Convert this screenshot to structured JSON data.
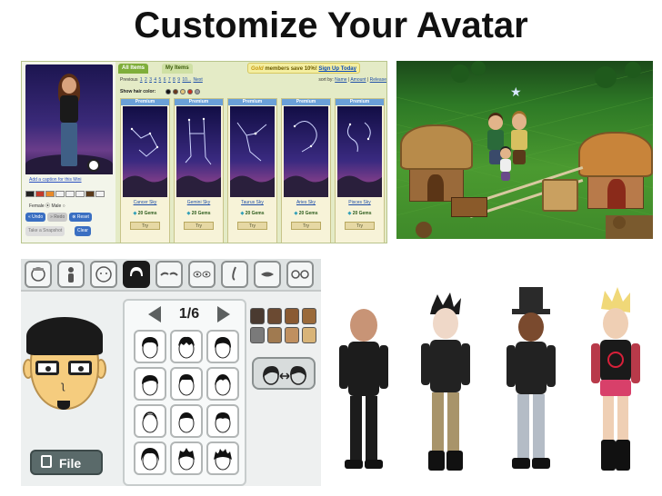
{
  "page": {
    "title": "Customize Your Avatar"
  },
  "imvu": {
    "caption_link": "Add a caption for this Mini",
    "gender_label": "Female ⦿  Male ○",
    "buttons": {
      "undo": "« Undo",
      "redo": "» Redo",
      "reset": "⊗ Reset",
      "snapshot": "Take a Snapshot",
      "clear": "Clear"
    },
    "tabs": {
      "all": "All Items",
      "my": "My Items"
    },
    "promo": {
      "brand": "Gold",
      "text": "members save 10%!",
      "signup": "Sign Up Today"
    },
    "pager": {
      "previous": "Previous",
      "pages": [
        "1",
        "2",
        "3",
        "4",
        "5",
        "6",
        "7",
        "8",
        "9",
        "10..."
      ],
      "next": "Next"
    },
    "sort": {
      "label": "sort by:",
      "options": [
        "Name",
        "Amount",
        "Release"
      ]
    },
    "hair_color_label": "Show hair color:",
    "hair_colors": [
      "#111111",
      "#6b3a1a",
      "#e4c77a",
      "#c83222",
      "#9a9a9a"
    ],
    "swatch_colors": [
      "#222222",
      "#c23a2a",
      "#e88a2a",
      "#f2f2f2",
      "#f2f2f2",
      "#f2f2f2",
      "#5a3a1a",
      "#f2f2f2"
    ],
    "items": [
      {
        "badge": "Premium",
        "name": "Cancer Sky",
        "price": "20 Gems",
        "try": "Try"
      },
      {
        "badge": "Premium",
        "name": "Gemini Sky",
        "price": "20 Gems",
        "try": "Try"
      },
      {
        "badge": "Premium",
        "name": "Taurus Sky",
        "price": "20 Gems",
        "try": "Try"
      },
      {
        "badge": "Premium",
        "name": "Aries Sky",
        "price": "20 Gems",
        "try": "Try"
      },
      {
        "badge": "Premium",
        "name": "Pisces Sky",
        "price": "20 Gems",
        "try": "Try"
      }
    ]
  },
  "mii": {
    "page_indicator": "1/6",
    "file_button": "File",
    "tabs": [
      "profile-icon",
      "body-icon",
      "face-icon",
      "hair-icon",
      "eyebrows-icon",
      "eyes-icon",
      "nose-icon",
      "mouth-icon",
      "glasses-icon"
    ],
    "hair_colors": [
      "#4a3a30",
      "#6b4a32",
      "#8a5a32",
      "#9a6a3a",
      "#7a7a7a",
      "#a07a50",
      "#c09060",
      "#d8b478"
    ]
  },
  "colors": {
    "imvu_bg": "#e4ebc6",
    "mii_bg": "#eef0f0",
    "farm_grass": "#4b9a30"
  }
}
